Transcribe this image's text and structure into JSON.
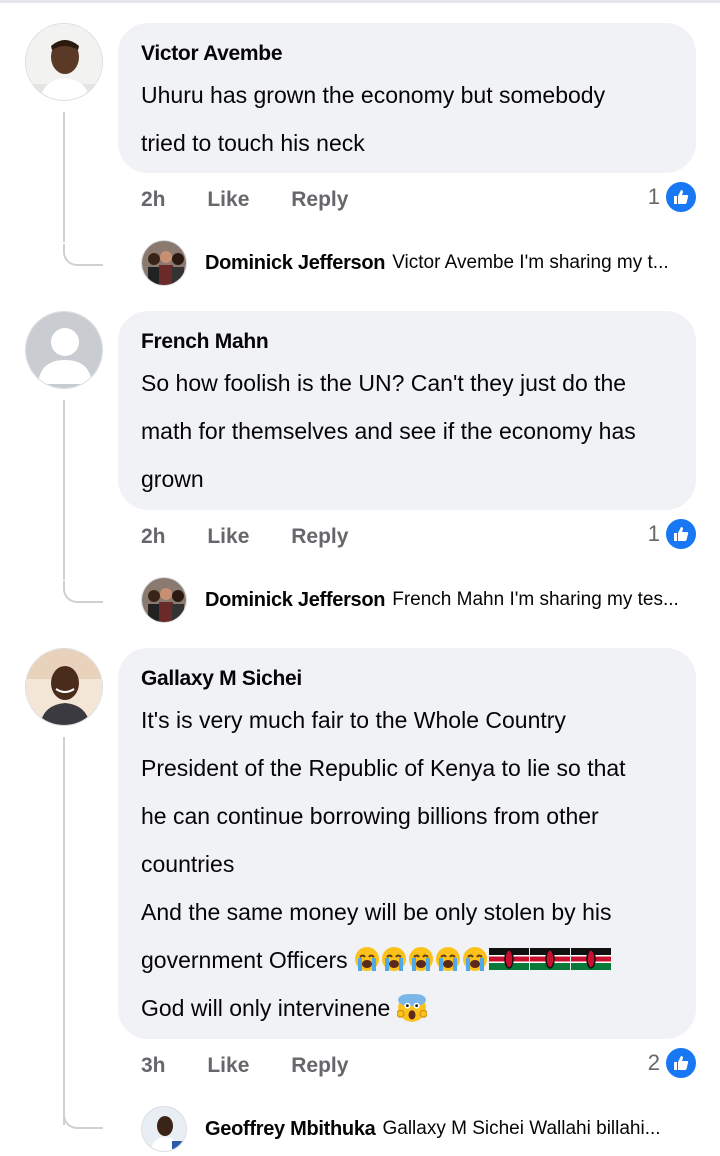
{
  "comments": [
    {
      "author": "Victor Avembe",
      "lines": [
        "Uhuru has grown the economy but somebody",
        "tried to touch his neck"
      ],
      "time": "2h",
      "like_label": "Like",
      "reply_label": "Reply",
      "reaction_count": "1",
      "reply": {
        "author": "Dominick Jefferson",
        "text": "Victor Avembe I'm sharing my t..."
      }
    },
    {
      "author": "French Mahn",
      "lines": [
        "So how foolish is the UN? Can't they just do the",
        "math for themselves and see if the economy has",
        "grown"
      ],
      "time": "2h",
      "like_label": "Like",
      "reply_label": "Reply",
      "reaction_count": "1",
      "reply": {
        "author": "Dominick Jefferson",
        "text": "French Mahn I'm sharing my tes..."
      }
    },
    {
      "author": "Gallaxy M Sichei",
      "lines": [
        "It's is very much fair to the Whole Country",
        "President of the Republic of Kenya to lie so that",
        "he can continue borrowing billions from other",
        "countries",
        "And the same money will be only stolen by his",
        "government Officers",
        "God will only intervinene"
      ],
      "time": "3h",
      "like_label": "Like",
      "reply_label": "Reply",
      "reaction_count": "2",
      "reply": {
        "author": "Geoffrey Mbithuka",
        "text": "Gallaxy M Sichei Wallahi billahi..."
      }
    }
  ],
  "colors": {
    "like_blue": "#1877f2",
    "bubble_bg": "#f0f2f5",
    "meta_gray": "#65676b"
  },
  "icons": {
    "reaction": "thumbs-up-icon",
    "crying_emoji": "loudly-crying-face-emoji",
    "flag_emoji": "kenya-flag-emoji",
    "scream_emoji": "face-screaming-in-fear-emoji"
  }
}
